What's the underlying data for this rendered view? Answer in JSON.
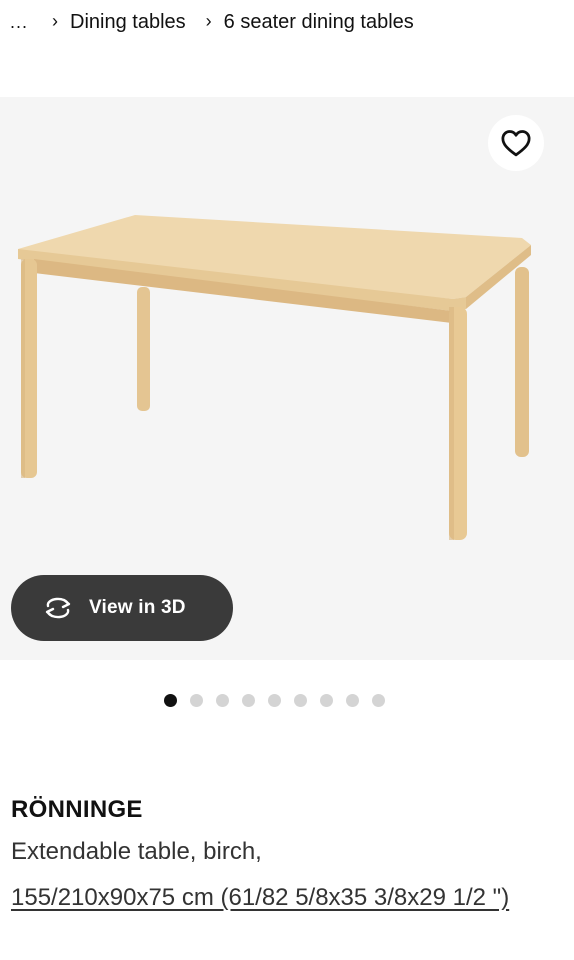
{
  "breadcrumb": {
    "ellipsis": "...",
    "items": [
      {
        "label": "Dining tables"
      },
      {
        "label": "6 seater dining tables"
      }
    ]
  },
  "product_image": {
    "favorite_icon": "heart-outline-icon",
    "view_3d_label": "View in 3D",
    "view_3d_icon": "rotate-3d-icon",
    "background_color": "#f5f5f5",
    "button_color": "#3a3a3a"
  },
  "carousel": {
    "total": 9,
    "active_index": 0
  },
  "product": {
    "name": "RÖNNINGE",
    "description": "Extendable table, birch,",
    "dimensions": "155/210x90x75 cm (61/82 5/8x35 3/8x29 1/2 \")"
  }
}
